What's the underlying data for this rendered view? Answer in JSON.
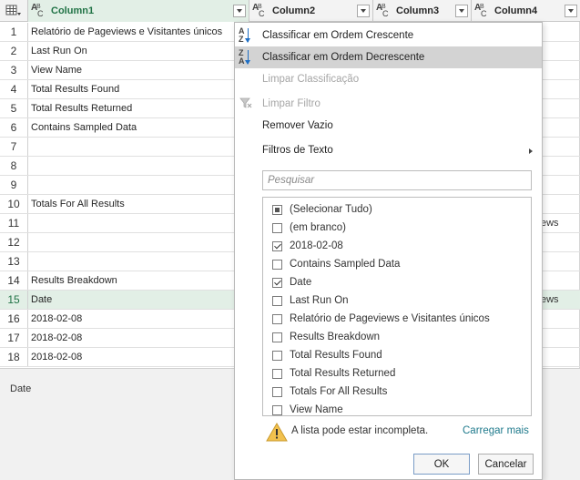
{
  "columns": [
    {
      "name": "Column1",
      "type_icon": "abc-text-type-icon"
    },
    {
      "name": "Column2",
      "type_icon": "abc-text-type-icon"
    },
    {
      "name": "Column3",
      "type_icon": "abc-text-type-icon"
    },
    {
      "name": "Column4",
      "type_icon": "abc-text-type-icon"
    }
  ],
  "rows": [
    {
      "num": "1",
      "col1": "Relatório de Pageviews e Visitantes únicos",
      "col4": ""
    },
    {
      "num": "2",
      "col1": "Last Run On",
      "col4": ""
    },
    {
      "num": "3",
      "col1": "View Name",
      "col4": ""
    },
    {
      "num": "4",
      "col1": "Total Results Found",
      "col4": ""
    },
    {
      "num": "5",
      "col1": "Total Results Returned",
      "col4": ""
    },
    {
      "num": "6",
      "col1": "Contains Sampled Data",
      "col4": ""
    },
    {
      "num": "7",
      "col1": "",
      "col4": ""
    },
    {
      "num": "8",
      "col1": "",
      "col4": ""
    },
    {
      "num": "9",
      "col1": "",
      "col4": ""
    },
    {
      "num": "10",
      "col1": "Totals For All Results",
      "col4": ""
    },
    {
      "num": "11",
      "col1": "",
      "col4": "ews"
    },
    {
      "num": "12",
      "col1": "",
      "col4": ""
    },
    {
      "num": "13",
      "col1": "",
      "col4": ""
    },
    {
      "num": "14",
      "col1": "Results Breakdown",
      "col4": ""
    },
    {
      "num": "15",
      "col1": "Date",
      "col4": "ews"
    },
    {
      "num": "16",
      "col1": "2018-02-08",
      "col4": ""
    },
    {
      "num": "17",
      "col1": "2018-02-08",
      "col4": ""
    },
    {
      "num": "18",
      "col1": "2018-02-08",
      "col4": ""
    }
  ],
  "status": {
    "text": "Date"
  },
  "menu": {
    "sort_asc": "Classificar em Ordem Crescente",
    "sort_desc": "Classificar em Ordem Decrescente",
    "clear_sort": "Limpar Classificação",
    "clear_filter": "Limpar Filtro",
    "remove_empty": "Remover Vazio",
    "text_filters": "Filtros de Texto",
    "search_placeholder": "Pesquisar",
    "items": [
      {
        "label": "(Selecionar Tudo)",
        "state": "partial"
      },
      {
        "label": "(em branco)",
        "state": "unchecked"
      },
      {
        "label": "2018-02-08",
        "state": "checked"
      },
      {
        "label": "Contains Sampled Data",
        "state": "unchecked"
      },
      {
        "label": "Date",
        "state": "checked"
      },
      {
        "label": "Last Run On",
        "state": "unchecked"
      },
      {
        "label": "Relatório de Pageviews e Visitantes únicos",
        "state": "unchecked"
      },
      {
        "label": "Results Breakdown",
        "state": "unchecked"
      },
      {
        "label": "Total Results Found",
        "state": "unchecked"
      },
      {
        "label": "Total Results Returned",
        "state": "unchecked"
      },
      {
        "label": "Totals For All Results",
        "state": "unchecked"
      },
      {
        "label": "View Name",
        "state": "unchecked"
      }
    ],
    "warning": "A lista pode estar incompleta.",
    "load_more": "Carregar mais",
    "ok": "OK",
    "cancel": "Cancelar"
  },
  "colors": {
    "accent_green": "#217346",
    "selected_row": "#e2efe6",
    "highlight_menu": "#d3d3d3",
    "link": "#1f7a8c"
  }
}
